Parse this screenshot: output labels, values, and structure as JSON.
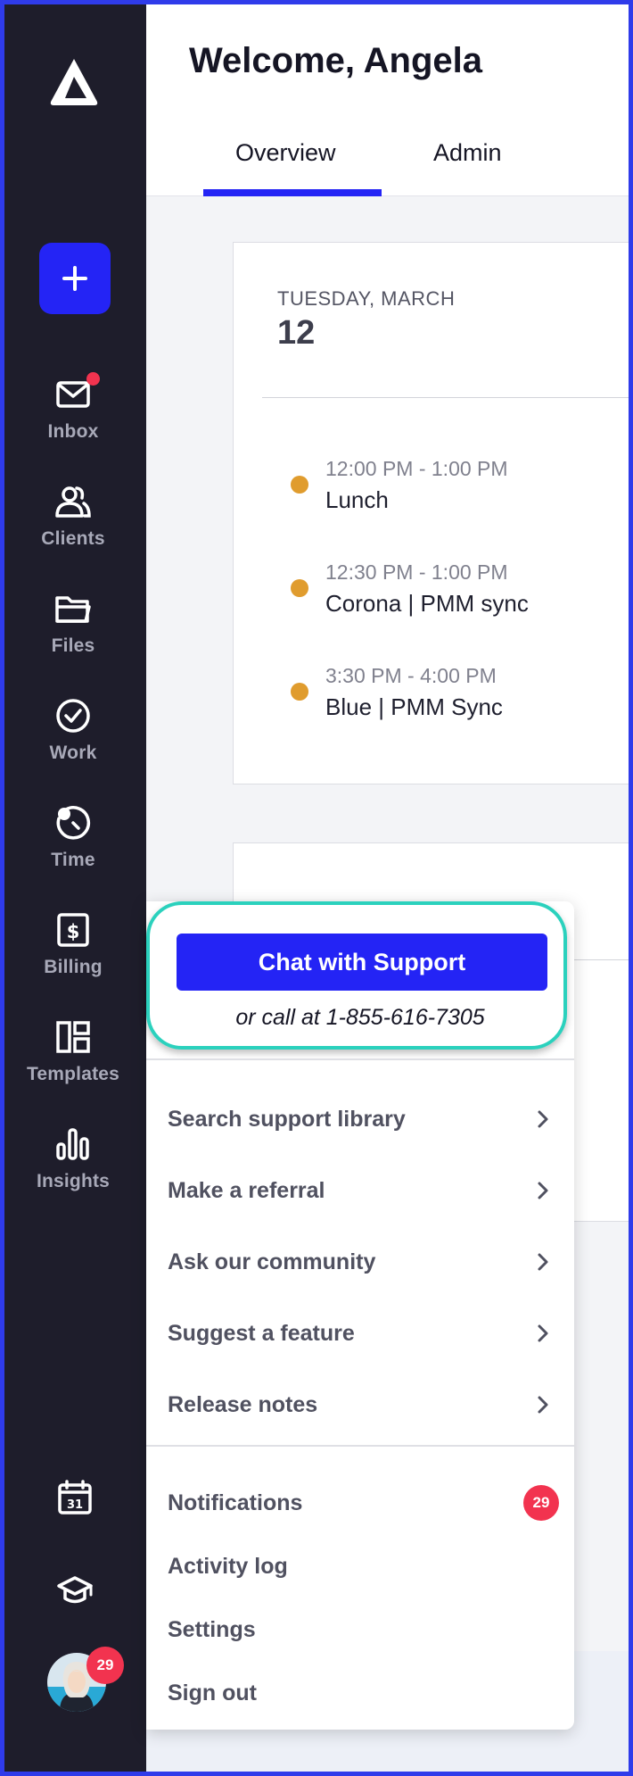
{
  "header": {
    "title": "Welcome, Angela",
    "tabs": [
      {
        "label": "Overview",
        "active": true
      },
      {
        "label": "Admin",
        "active": false
      }
    ]
  },
  "sidebar": {
    "new_button_icon": "plus-icon",
    "items": [
      {
        "label": "Inbox",
        "icon": "mail-icon",
        "has_notification_dot": true
      },
      {
        "label": "Clients",
        "icon": "users-icon"
      },
      {
        "label": "Files",
        "icon": "folder-icon"
      },
      {
        "label": "Work",
        "icon": "check-circle-icon"
      },
      {
        "label": "Time",
        "icon": "clock-icon"
      },
      {
        "label": "Billing",
        "icon": "dollar-doc-icon"
      },
      {
        "label": "Templates",
        "icon": "templates-icon"
      },
      {
        "label": "Insights",
        "icon": "bar-chart-icon"
      }
    ],
    "bottom_icons": [
      "calendar-icon",
      "graduation-cap-icon"
    ],
    "calendar_day": "31",
    "avatar_badge": "29"
  },
  "calendar_card": {
    "day_label": "TUESDAY, MARCH",
    "day_number": "12",
    "events": [
      {
        "time": "12:00 PM - 1:00 PM",
        "name": "Lunch"
      },
      {
        "time": "12:30 PM - 1:00 PM",
        "name": "Corona | PMM sync"
      },
      {
        "time": "3:30 PM - 4:00 PM",
        "name": "Blue | PMM Sync"
      }
    ]
  },
  "support_menu": {
    "chat_button": "Chat with Support",
    "call_text": "or call at 1-855-616-7305",
    "links": [
      "Search support library",
      "Make a referral",
      "Ask our community",
      "Suggest a feature",
      "Release notes"
    ],
    "account": [
      {
        "label": "Notifications",
        "badge": "29"
      },
      {
        "label": "Activity log"
      },
      {
        "label": "Settings"
      },
      {
        "label": "Sign out"
      }
    ]
  },
  "colors": {
    "accent": "#2424f5",
    "sidebar_bg": "#1e1d2b",
    "highlight": "#2bd1bd",
    "badge": "#f2334f",
    "event_dot": "#e09c2e"
  }
}
